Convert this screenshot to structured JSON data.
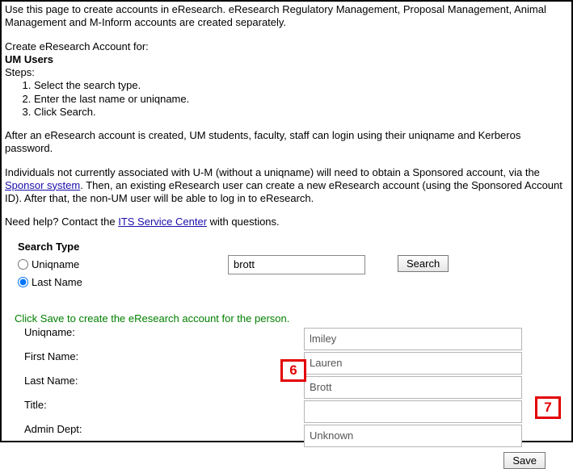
{
  "intro": {
    "p1": "Use this page to create accounts in eResearch. eResearch Regulatory Management, Proposal Management, Animal Management and M-Inform accounts are created separately.",
    "p2": "Create eResearch Account for:",
    "um_users": "UM Users",
    "steps_label": "Steps:",
    "steps": [
      "Select the search type.",
      "Enter the last name or uniqname.",
      "Click Search."
    ],
    "p3": "After an eResearch account is created, UM students, faculty, staff can login using their uniqname and Kerberos password.",
    "p4a": "Individuals not currently associated with U-M (without a uniqname) will need to obtain a Sponsored account, via the ",
    "p4_link": "Sponsor system",
    "p4b": ". Then, an existing eResearch user can create a new eResearch account (using the Sponsored Account ID). After that, the non-UM user will be able to log in to eResearch.",
    "help_a": "Need help? Contact the ",
    "help_link": "ITS Service Center",
    "help_b": " with questions."
  },
  "search": {
    "heading": "Search Type",
    "opt_uniqname": "Uniqname",
    "opt_lastname": "Last Name",
    "value": "brott",
    "button": "Search"
  },
  "save_hint": "Click Save to create the eResearch account for the person.",
  "details": {
    "labels": {
      "uniqname": "Uniqname:",
      "first": "First Name:",
      "last": "Last Name:",
      "title": "Title:",
      "dept": "Admin Dept:"
    },
    "values": {
      "uniqname": "lmiley",
      "first": "Lauren",
      "last": "Brott",
      "title": "",
      "dept": "Unknown"
    }
  },
  "save_button": "Save",
  "callouts": {
    "six": "6",
    "seven": "7"
  }
}
